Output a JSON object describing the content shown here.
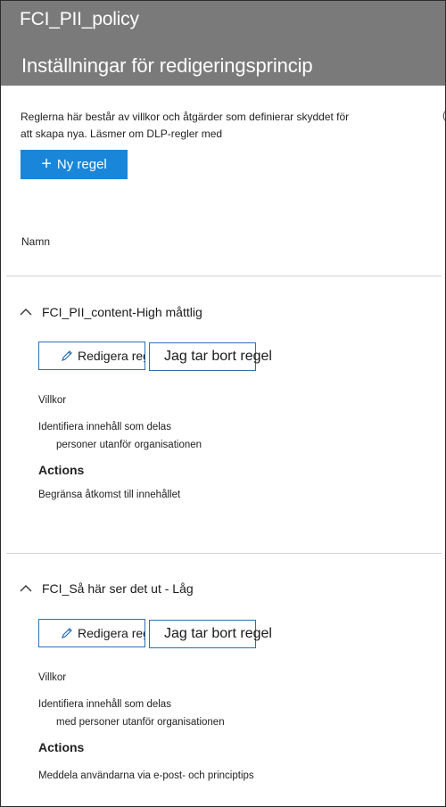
{
  "header": {
    "policy_name": "FCI_PII_policy",
    "title": "Inställningar för redigeringsprincip"
  },
  "intro": {
    "text": "Reglerna här består av villkor och åtgärder som definierar skyddet för att skapa nya. Läsmer om DLP-regler med",
    "edge_mark": "("
  },
  "toolbar": {
    "new_rule_label": "Ny regel"
  },
  "list": {
    "column_name": "Namn"
  },
  "rules": [
    {
      "name": "FCI_PII_content-High måttlig",
      "edit_label": "Redigera regel",
      "delete_label": "Jag tar bort regel",
      "conditions_label": "Villkor",
      "condition_line1": "Identifiera innehåll som delas",
      "condition_line2": "personer utanför organisationen",
      "actions_label": "Actions",
      "action_text": "Begränsa åtkomst till innehållet"
    },
    {
      "name": "FCI_Så här ser det ut - Låg",
      "edit_label": "Redigera regel",
      "delete_label": "Jag tar bort regel",
      "conditions_label": "Villkor",
      "condition_line1": "Identifiera innehåll som delas",
      "condition_line2": "med personer utanför organisationen",
      "actions_label": "Actions",
      "action_text": "Meddela användarna via e-post- och principtips"
    }
  ],
  "colors": {
    "header_bg": "#7a7a7a",
    "primary": "#1a86d9",
    "button_border": "#2d6fb4"
  },
  "icons": {
    "add": "plus-icon",
    "collapse": "chevron-up-icon",
    "edit": "pencil-icon"
  }
}
